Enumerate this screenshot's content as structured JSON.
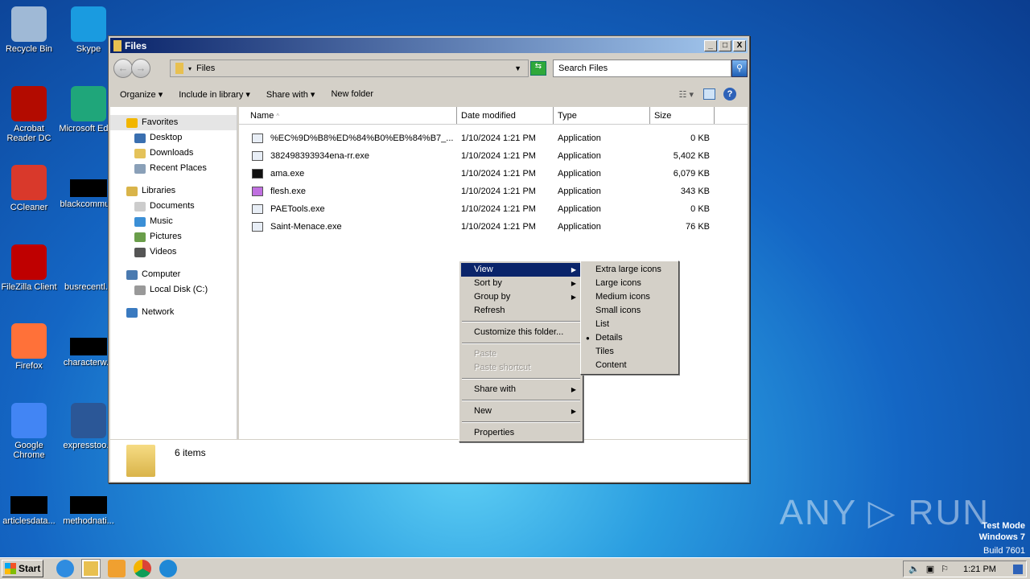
{
  "desktop": {
    "icons": [
      {
        "label": "Recycle Bin",
        "color": "#9fb9d6"
      },
      {
        "label": "Skype",
        "color": "#1a9be0"
      },
      {
        "label": "Acrobat Reader DC",
        "color": "#b30b00"
      },
      {
        "label": "Microsoft Edge",
        "color": "#1fa67a"
      },
      {
        "label": "CCleaner",
        "color": "#d9392b"
      },
      {
        "label": "blackcommu...",
        "color": "#000"
      },
      {
        "label": "FileZilla Client",
        "color": "#bf0000"
      },
      {
        "label": "busrecentl...",
        "color": "none"
      },
      {
        "label": "Firefox",
        "color": "#ff7139"
      },
      {
        "label": "characterw...",
        "color": "#000"
      },
      {
        "label": "Google Chrome",
        "color": "#4285f4"
      },
      {
        "label": "expresstoo...",
        "color": "#2b5797"
      },
      {
        "label": "articlesdata...",
        "color": "#000"
      },
      {
        "label": "methodnati...",
        "color": "#000"
      }
    ]
  },
  "window": {
    "title": "Files",
    "minimize": "_",
    "maximize": "□",
    "close": "X",
    "address": "Files",
    "search_placeholder": "Search Files",
    "toolbar": {
      "organize": "Organize ▾",
      "include": "Include in library ▾",
      "share": "Share with ▾",
      "new_folder": "New folder"
    },
    "nav": [
      {
        "label": "Favorites",
        "level": 0,
        "color": "#f2b600"
      },
      {
        "label": "Desktop",
        "level": 1,
        "color": "#3a6fb0"
      },
      {
        "label": "Downloads",
        "level": 1,
        "color": "#e4c25a"
      },
      {
        "label": "Recent Places",
        "level": 1,
        "color": "#8aa0b8"
      },
      {
        "label": "Libraries",
        "level": 0,
        "color": "#d9b44a"
      },
      {
        "label": "Documents",
        "level": 1,
        "color": "#ccc"
      },
      {
        "label": "Music",
        "level": 1,
        "color": "#3b8fd6"
      },
      {
        "label": "Pictures",
        "level": 1,
        "color": "#6a9e4a"
      },
      {
        "label": "Videos",
        "level": 1,
        "color": "#555"
      },
      {
        "label": "Computer",
        "level": 0,
        "color": "#4a7ab0"
      },
      {
        "label": "Local Disk (C:)",
        "level": 1,
        "color": "#999"
      },
      {
        "label": "Network",
        "level": 0,
        "color": "#3a7ac0"
      }
    ],
    "columns": {
      "name": "Name",
      "date": "Date modified",
      "type": "Type",
      "size": "Size"
    },
    "files": [
      {
        "name": "%EC%9D%B8%ED%84%B0%EB%84%B7_...",
        "date": "1/10/2024 1:21 PM",
        "type": "Application",
        "size": "0 KB"
      },
      {
        "name": "382498393934ena-rr.exe",
        "date": "1/10/2024 1:21 PM",
        "type": "Application",
        "size": "5,402 KB"
      },
      {
        "name": "ama.exe",
        "date": "1/10/2024 1:21 PM",
        "type": "Application",
        "size": "6,079 KB"
      },
      {
        "name": "flesh.exe",
        "date": "1/10/2024 1:21 PM",
        "type": "Application",
        "size": "343 KB"
      },
      {
        "name": "PAETools.exe",
        "date": "1/10/2024 1:21 PM",
        "type": "Application",
        "size": "0 KB"
      },
      {
        "name": "Saint-Menace.exe",
        "date": "1/10/2024 1:21 PM",
        "type": "Application",
        "size": "76 KB"
      }
    ],
    "status": "6 items"
  },
  "context_menu": {
    "view": "View",
    "sort_by": "Sort by",
    "group_by": "Group by",
    "refresh": "Refresh",
    "customize": "Customize this folder...",
    "paste": "Paste",
    "paste_shortcut": "Paste shortcut",
    "share_with": "Share with",
    "new": "New",
    "properties": "Properties"
  },
  "view_submenu": {
    "items": [
      "Extra large icons",
      "Large icons",
      "Medium icons",
      "Small icons",
      "List",
      "Details",
      "Tiles",
      "Content"
    ],
    "selected": "Details"
  },
  "taskbar": {
    "start": "Start",
    "clock": "1:21 PM"
  },
  "watermark": {
    "logo": "ANY RUN",
    "line1": "Test Mode",
    "line2": "Windows 7",
    "line3": "Build 7601"
  }
}
